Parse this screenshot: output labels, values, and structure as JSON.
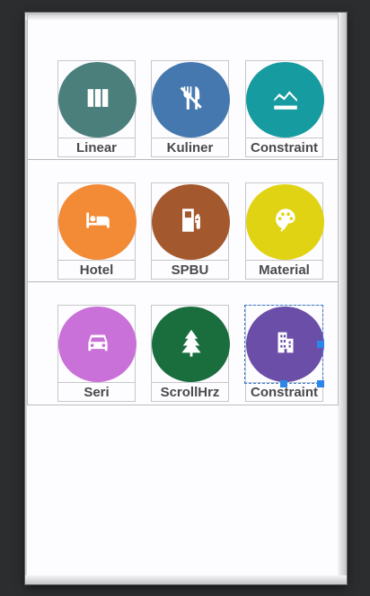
{
  "grid": {
    "items": [
      {
        "label": "Linear",
        "icon": "column-view-icon",
        "color": "#4a7f7c"
      },
      {
        "label": "Kuliner",
        "icon": "no-food-icon",
        "color": "#4478ae"
      },
      {
        "label": "Constraint",
        "icon": "area-chart-icon",
        "color": "#169ba0"
      },
      {
        "label": "Hotel",
        "icon": "bed-icon",
        "color": "#f28a36"
      },
      {
        "label": "SPBU",
        "icon": "gas-station-icon",
        "color": "#a4582e"
      },
      {
        "label": "Material",
        "icon": "palette-icon",
        "color": "#dfd313"
      },
      {
        "label": "Seri",
        "icon": "car-icon",
        "color": "#c971d8"
      },
      {
        "label": "ScrollHrz",
        "icon": "tree-icon",
        "color": "#1a6e3e"
      },
      {
        "label": "Constraint",
        "icon": "apartment-icon",
        "color": "#6b4ea7"
      }
    ]
  },
  "selection": {
    "color": "#2a86e8"
  }
}
